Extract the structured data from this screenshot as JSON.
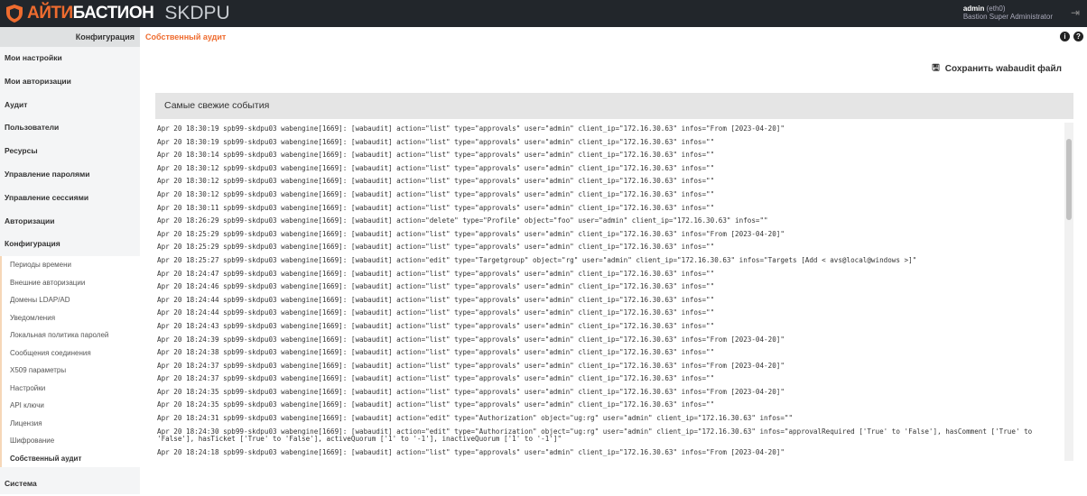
{
  "header": {
    "brand_accent": "АЙТИ",
    "brand_rest": "БАСТИОН",
    "product": "SKDPU",
    "user": "admin",
    "iface": "(eth0)",
    "role": "Bastion Super Administrator",
    "accent": "#ef6c2f"
  },
  "breadcrumb": {
    "section": "Конфигурация",
    "page": "Собственный аудит"
  },
  "sidebar": {
    "items": [
      "Мои настройки",
      "Мои авторизации",
      "Аудит",
      "Пользователи",
      "Ресурсы",
      "Управление паролями",
      "Управление сессиями",
      "Авторизации",
      "Конфигурация"
    ],
    "sub": [
      "Периоды времени",
      "Внешние авторизации",
      "Домены LDAP/AD",
      "Уведомления",
      "Локальная политика паролей",
      "Сообщения соединения",
      "X509 параметры",
      "Настройки",
      "API ключи",
      "Лицензия",
      "Шифрование",
      "Собственный аудит"
    ],
    "last": "Система"
  },
  "save_label": "Сохранить wabaudit файл",
  "panel_title": "Самые свежие события",
  "log": [
    "Apr 20 18:30:19 spb99-skdpu03 wabengine[1669]: [wabaudit] action=\"list\" type=\"approvals\" user=\"admin\" client_ip=\"172.16.30.63\" infos=\"From [2023-04-20]\"",
    "Apr 20 18:30:19 spb99-skdpu03 wabengine[1669]: [wabaudit] action=\"list\" type=\"approvals\" user=\"admin\" client_ip=\"172.16.30.63\" infos=\"\"",
    "Apr 20 18:30:14 spb99-skdpu03 wabengine[1669]: [wabaudit] action=\"list\" type=\"approvals\" user=\"admin\" client_ip=\"172.16.30.63\" infos=\"\"",
    "Apr 20 18:30:12 spb99-skdpu03 wabengine[1669]: [wabaudit] action=\"list\" type=\"approvals\" user=\"admin\" client_ip=\"172.16.30.63\" infos=\"\"",
    "Apr 20 18:30:12 spb99-skdpu03 wabengine[1669]: [wabaudit] action=\"list\" type=\"approvals\" user=\"admin\" client_ip=\"172.16.30.63\" infos=\"\"",
    "Apr 20 18:30:12 spb99-skdpu03 wabengine[1669]: [wabaudit] action=\"list\" type=\"approvals\" user=\"admin\" client_ip=\"172.16.30.63\" infos=\"\"",
    "Apr 20 18:30:11 spb99-skdpu03 wabengine[1669]: [wabaudit] action=\"list\" type=\"approvals\" user=\"admin\" client_ip=\"172.16.30.63\" infos=\"\"",
    "Apr 20 18:26:29 spb99-skdpu03 wabengine[1669]: [wabaudit] action=\"delete\" type=\"Profile\" object=\"foo\" user=\"admin\" client_ip=\"172.16.30.63\" infos=\"\"",
    "Apr 20 18:25:29 spb99-skdpu03 wabengine[1669]: [wabaudit] action=\"list\" type=\"approvals\" user=\"admin\" client_ip=\"172.16.30.63\" infos=\"From [2023-04-20]\"",
    "Apr 20 18:25:29 spb99-skdpu03 wabengine[1669]: [wabaudit] action=\"list\" type=\"approvals\" user=\"admin\" client_ip=\"172.16.30.63\" infos=\"\"",
    "Apr 20 18:25:27 spb99-skdpu03 wabengine[1669]: [wabaudit] action=\"edit\" type=\"Targetgroup\" object=\"rg\" user=\"admin\" client_ip=\"172.16.30.63\" infos=\"Targets [Add < avs@local@windows >]\"",
    "Apr 20 18:24:47 spb99-skdpu03 wabengine[1669]: [wabaudit] action=\"list\" type=\"approvals\" user=\"admin\" client_ip=\"172.16.30.63\" infos=\"\"",
    "Apr 20 18:24:46 spb99-skdpu03 wabengine[1669]: [wabaudit] action=\"list\" type=\"approvals\" user=\"admin\" client_ip=\"172.16.30.63\" infos=\"\"",
    "Apr 20 18:24:44 spb99-skdpu03 wabengine[1669]: [wabaudit] action=\"list\" type=\"approvals\" user=\"admin\" client_ip=\"172.16.30.63\" infos=\"\"",
    "Apr 20 18:24:44 spb99-skdpu03 wabengine[1669]: [wabaudit] action=\"list\" type=\"approvals\" user=\"admin\" client_ip=\"172.16.30.63\" infos=\"\"",
    "Apr 20 18:24:43 spb99-skdpu03 wabengine[1669]: [wabaudit] action=\"list\" type=\"approvals\" user=\"admin\" client_ip=\"172.16.30.63\" infos=\"\"",
    "Apr 20 18:24:39 spb99-skdpu03 wabengine[1669]: [wabaudit] action=\"list\" type=\"approvals\" user=\"admin\" client_ip=\"172.16.30.63\" infos=\"From [2023-04-20]\"",
    "Apr 20 18:24:38 spb99-skdpu03 wabengine[1669]: [wabaudit] action=\"list\" type=\"approvals\" user=\"admin\" client_ip=\"172.16.30.63\" infos=\"\"",
    "Apr 20 18:24:37 spb99-skdpu03 wabengine[1669]: [wabaudit] action=\"list\" type=\"approvals\" user=\"admin\" client_ip=\"172.16.30.63\" infos=\"From [2023-04-20]\"",
    "Apr 20 18:24:37 spb99-skdpu03 wabengine[1669]: [wabaudit] action=\"list\" type=\"approvals\" user=\"admin\" client_ip=\"172.16.30.63\" infos=\"\"",
    "Apr 20 18:24:35 spb99-skdpu03 wabengine[1669]: [wabaudit] action=\"list\" type=\"approvals\" user=\"admin\" client_ip=\"172.16.30.63\" infos=\"From [2023-04-20]\"",
    "Apr 20 18:24:35 spb99-skdpu03 wabengine[1669]: [wabaudit] action=\"list\" type=\"approvals\" user=\"admin\" client_ip=\"172.16.30.63\" infos=\"\"",
    "Apr 20 18:24:31 spb99-skdpu03 wabengine[1669]: [wabaudit] action=\"edit\" type=\"Authorization\" object=\"ug:rg\" user=\"admin\" client_ip=\"172.16.30.63\" infos=\"\"",
    "Apr 20 18:24:30 spb99-skdpu03 wabengine[1669]: [wabaudit] action=\"edit\" type=\"Authorization\" object=\"ug:rg\" user=\"admin\" client_ip=\"172.16.30.63\" infos=\"approvalRequired ['True' to 'False'], hasComment ['True' to 'False'], hasTicket ['True' to 'False'], activeQuorum ['1' to '-1'], inactiveQuorum ['1' to '-1']\"",
    "Apr 20 18:24:18 spb99-skdpu03 wabengine[1669]: [wabaudit] action=\"list\" type=\"approvals\" user=\"admin\" client_ip=\"172.16.30.63\" infos=\"From [2023-04-20]\""
  ]
}
